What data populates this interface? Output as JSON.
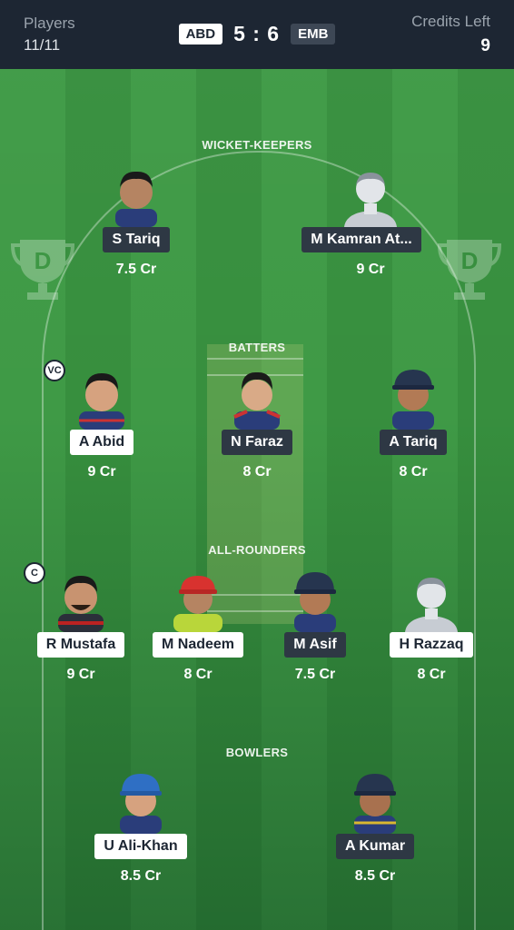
{
  "header": {
    "players_label": "Players",
    "players_value": "11/11",
    "team1": "ABD",
    "score": "5 : 6",
    "team2": "EMB",
    "credits_label": "Credits Left",
    "credits_value": "9"
  },
  "sections": {
    "wicket_keepers": "WICKET-KEEPERS",
    "batters": "BATTERS",
    "all_rounders": "ALL-ROUNDERS",
    "bowlers": "BOWLERS"
  },
  "badges": {
    "vc": "VC",
    "c": "C"
  },
  "players": {
    "wk1": {
      "name": "S Tariq",
      "credits": "7.5 Cr"
    },
    "wk2": {
      "name": "M Kamran At...",
      "credits": "9 Cr"
    },
    "bat1": {
      "name": "A Abid",
      "credits": "9 Cr"
    },
    "bat2": {
      "name": "N Faraz",
      "credits": "8 Cr"
    },
    "bat3": {
      "name": "A Tariq",
      "credits": "8 Cr"
    },
    "ar1": {
      "name": "R Mustafa",
      "credits": "9 Cr"
    },
    "ar2": {
      "name": "M Nadeem",
      "credits": "8 Cr"
    },
    "ar3": {
      "name": "M Asif",
      "credits": "7.5 Cr"
    },
    "ar4": {
      "name": "H Razzaq",
      "credits": "8 Cr"
    },
    "bowl1": {
      "name": "U Ali-Khan",
      "credits": "8.5 Cr"
    },
    "bowl2": {
      "name": "A Kumar",
      "credits": "8.5 Cr"
    }
  }
}
